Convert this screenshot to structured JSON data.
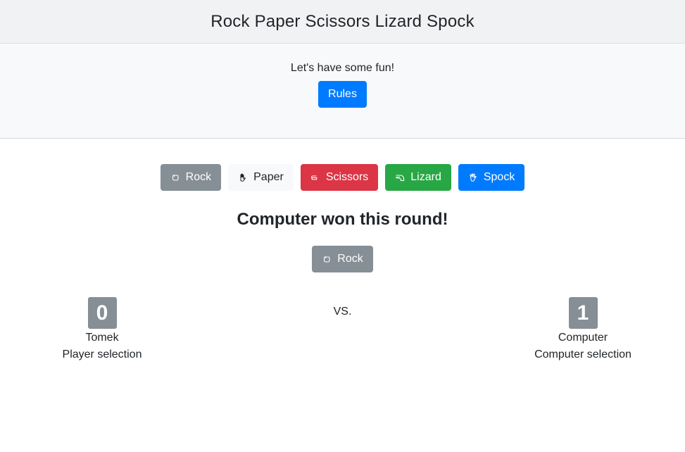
{
  "header": {
    "title": "Rock Paper Scissors Lizard Spock"
  },
  "intro": {
    "tagline": "Let's have some fun!",
    "rules_label": "Rules"
  },
  "choices": [
    {
      "label": "Rock",
      "icon": "hand-rock-icon",
      "color": "#868e96"
    },
    {
      "label": "Paper",
      "icon": "hand-paper-icon",
      "color": "#f8f9fa"
    },
    {
      "label": "Scissors",
      "icon": "hand-scissors-icon",
      "color": "#dc3545"
    },
    {
      "label": "Lizard",
      "icon": "hand-lizard-icon",
      "color": "#28a745"
    },
    {
      "label": "Spock",
      "icon": "hand-spock-icon",
      "color": "#007bff"
    }
  ],
  "round": {
    "result": "Computer won this round!",
    "computer_choice": {
      "label": "Rock",
      "icon": "hand-rock-icon"
    }
  },
  "score": {
    "player": {
      "points": "0",
      "name": "Tomek",
      "caption": "Player selection"
    },
    "vs": "VS.",
    "computer": {
      "points": "1",
      "name": "Computer",
      "caption": "Computer selection"
    }
  }
}
